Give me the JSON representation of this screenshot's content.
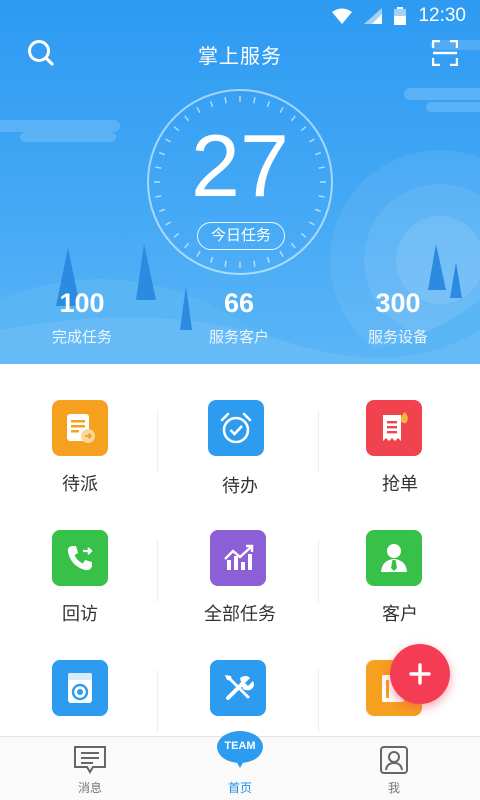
{
  "status": {
    "time": "12:30"
  },
  "header": {
    "title": "掌上服务"
  },
  "hero": {
    "today_count": "27",
    "today_label": "今日任务",
    "stats": [
      {
        "value": "100",
        "label": "完成任务"
      },
      {
        "value": "66",
        "label": "服务客户"
      },
      {
        "value": "300",
        "label": "服务设备"
      }
    ]
  },
  "grid": {
    "items": [
      {
        "label": "待派",
        "icon": "dispatch-icon",
        "color": "#f5a01f"
      },
      {
        "label": "待办",
        "icon": "alarm-clock-icon",
        "color": "#2d9bf0"
      },
      {
        "label": "抢单",
        "icon": "grab-order-icon",
        "color": "#f0434e"
      },
      {
        "label": "回访",
        "icon": "phone-callback-icon",
        "color": "#37c148"
      },
      {
        "label": "全部任务",
        "icon": "chart-icon",
        "color": "#8c5fd6"
      },
      {
        "label": "客户",
        "icon": "customer-icon",
        "color": "#37c148"
      },
      {
        "label": "",
        "icon": "washer-icon",
        "color": "#2d9bf0"
      },
      {
        "label": "",
        "icon": "tools-icon",
        "color": "#2d9bf0"
      },
      {
        "label": "",
        "icon": "document-icon",
        "color": "#f5a01f"
      }
    ]
  },
  "bottom_nav": {
    "items": [
      {
        "label": "消息",
        "icon": "message-icon"
      },
      {
        "label": "首页",
        "icon": "team-icon",
        "badge": "TEAM"
      },
      {
        "label": "我",
        "icon": "profile-icon"
      }
    ]
  },
  "fab": {
    "icon": "plus-icon",
    "color": "#f43d55"
  }
}
